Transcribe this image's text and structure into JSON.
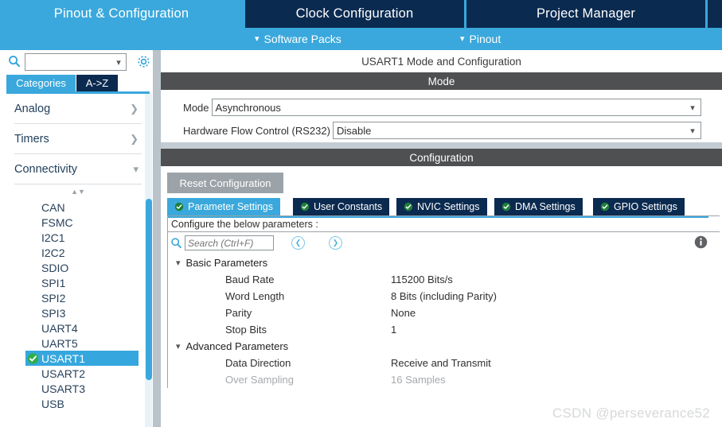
{
  "main_tabs": [
    {
      "label": "Pinout & Configuration",
      "active": true
    },
    {
      "label": "Clock Configuration",
      "active": false
    },
    {
      "label": "Project Manager",
      "active": false
    },
    {
      "label": "",
      "active": false
    }
  ],
  "sub_bar": {
    "items": [
      {
        "label": "Software Packs",
        "icon": "chevron-down-icon"
      },
      {
        "label": "Pinout",
        "icon": "chevron-down-icon"
      }
    ]
  },
  "sidebar": {
    "search": {
      "value": "",
      "placeholder": "",
      "icon": "search-icon"
    },
    "gear_icon": "gear-icon",
    "tabs": [
      {
        "label": "Categories",
        "active": true
      },
      {
        "label": "A->Z",
        "active": false
      }
    ],
    "categories": [
      {
        "label": "Analog",
        "expanded": false,
        "arrow": "chevron-right-icon"
      },
      {
        "label": "Timers",
        "expanded": false,
        "arrow": "chevron-right-icon"
      },
      {
        "label": "Connectivity",
        "expanded": true,
        "arrow": "chevron-down-icon"
      }
    ],
    "peripherals": [
      {
        "label": "CAN",
        "selected": false,
        "checked": false
      },
      {
        "label": "FSMC",
        "selected": false,
        "checked": false
      },
      {
        "label": "I2C1",
        "selected": false,
        "checked": false
      },
      {
        "label": "I2C2",
        "selected": false,
        "checked": false
      },
      {
        "label": "SDIO",
        "selected": false,
        "checked": false
      },
      {
        "label": "SPI1",
        "selected": false,
        "checked": false
      },
      {
        "label": "SPI2",
        "selected": false,
        "checked": false
      },
      {
        "label": "SPI3",
        "selected": false,
        "checked": false
      },
      {
        "label": "UART4",
        "selected": false,
        "checked": false
      },
      {
        "label": "UART5",
        "selected": false,
        "checked": false
      },
      {
        "label": "USART1",
        "selected": true,
        "checked": true
      },
      {
        "label": "USART2",
        "selected": false,
        "checked": false
      },
      {
        "label": "USART3",
        "selected": false,
        "checked": false
      },
      {
        "label": "USB",
        "selected": false,
        "checked": false
      }
    ]
  },
  "main": {
    "panel_title": "USART1 Mode and Configuration",
    "mode_section": {
      "header": "Mode",
      "fields": [
        {
          "label": "Mode",
          "value": "Asynchronous",
          "chevron": "chevron-down-icon"
        },
        {
          "label": "Hardware Flow Control (RS232)",
          "value": "Disable",
          "chevron": "chevron-down-icon"
        }
      ]
    },
    "config_section": {
      "header": "Configuration",
      "reset_label": "Reset Configuration",
      "tabs": [
        {
          "label": "Parameter Settings",
          "active": true,
          "icon": "check-circle-icon"
        },
        {
          "label": "User Constants",
          "active": false,
          "icon": "check-circle-icon"
        },
        {
          "label": "NVIC Settings",
          "active": false,
          "icon": "check-circle-icon"
        },
        {
          "label": "DMA Settings",
          "active": false,
          "icon": "check-circle-icon"
        },
        {
          "label": "GPIO Settings",
          "active": false,
          "icon": "check-circle-icon"
        }
      ],
      "configure_hint": "Configure the below parameters :",
      "search": {
        "placeholder": "Search (Ctrl+F)",
        "value": "",
        "icon": "search-icon"
      },
      "nav_prev_icon": "chevron-left-circle-icon",
      "nav_next_icon": "chevron-right-circle-icon",
      "info_icon": "info-icon",
      "groups": [
        {
          "label": "Basic Parameters",
          "expanded": true,
          "chevron": "chevron-down-icon",
          "rows": [
            {
              "name": "Baud Rate",
              "value": "115200 Bits/s",
              "disabled": false
            },
            {
              "name": "Word Length",
              "value": "8 Bits (including Parity)",
              "disabled": false
            },
            {
              "name": "Parity",
              "value": "None",
              "disabled": false
            },
            {
              "name": "Stop Bits",
              "value": "1",
              "disabled": false
            }
          ]
        },
        {
          "label": "Advanced Parameters",
          "expanded": true,
          "chevron": "chevron-down-icon",
          "rows": [
            {
              "name": "Data Direction",
              "value": "Receive and Transmit",
              "disabled": false
            },
            {
              "name": "Over Sampling",
              "value": "16 Samples",
              "disabled": true
            }
          ]
        }
      ]
    }
  },
  "watermark": "CSDN @perseverance52",
  "colors": {
    "accent_blue": "#3aa8dc",
    "navy": "#0b2a50",
    "header_grey": "#4f5052",
    "selected_row": "#36a7de",
    "check_green": "#2eaf4e",
    "disabled_text": "#a5a9ad",
    "button_grey": "#9ba3a9"
  }
}
